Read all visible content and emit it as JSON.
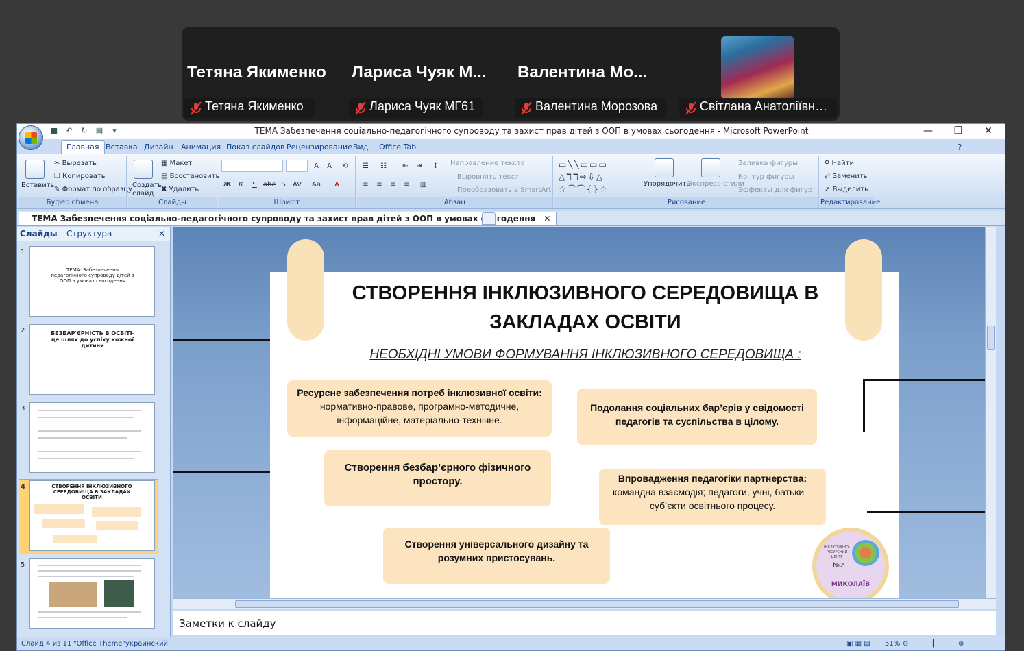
{
  "meeting_strip": {
    "participants": [
      {
        "display_name": "Тетяна Якименко",
        "tag_name": "Тетяна Якименко"
      },
      {
        "display_name": "Лариса Чуяк М...",
        "tag_name": "Лариса Чуяк МГ61"
      },
      {
        "display_name": "Валентина Мо...",
        "tag_name": "Валентина Морозова"
      },
      {
        "display_name": "",
        "tag_name": "Світлана Анатоліївна ..."
      }
    ]
  },
  "window": {
    "title": "ТЕМА Забезпечення соціально-педагогічного супроводу та захист прав дітей з ООП в умовах сьогодення  - Microsoft PowerPoint",
    "minimize": "—",
    "maximize": "❐",
    "close": "✕"
  },
  "ribbon_tabs": [
    "Главная",
    "Вставка",
    "Дизайн",
    "Анимация",
    "Показ слайдов",
    "Рецензирование",
    "Вид",
    "Office Tab"
  ],
  "ribbon": {
    "clipboard": {
      "paste": "Вставить",
      "cut": "Вырезать",
      "copy": "Копировать",
      "format_painter": "Формат по образцу",
      "label": "Буфер обмена"
    },
    "slides": {
      "new_slide": "Создать слайд",
      "layout": "Макет",
      "reset": "Восстановить",
      "delete": "Удалить",
      "label": "Слайды"
    },
    "font": {
      "label": "Шрифт"
    },
    "paragraph": {
      "text_direction": "Направление текста",
      "align_text": "Выровнять текст",
      "smartart": "Преобразовать в SmartArt",
      "label": "Абзац"
    },
    "drawing": {
      "arrange": "Упорядочить",
      "quick_styles": "Экспресс-стили",
      "fill": "Заливка фигуры",
      "outline": "Контур фигуры",
      "effects": "Эффекты для фигур",
      "label": "Рисование"
    },
    "editing": {
      "find": "Найти",
      "replace": "Заменить",
      "select": "Выделить",
      "label": "Редактирование"
    }
  },
  "document_tab": "ТЕМА Забезпечення соціально-педагогічного супроводу та захист прав дітей з ООП в умовах сьогодення",
  "pane": {
    "tab_slides": "Слайды",
    "tab_outline": "Структура",
    "thumbnails": [
      {
        "number": "1",
        "text": "ТЕМА: Забезпечення педагогічного супроводу дітей з ООП в умовах сьогодення"
      },
      {
        "number": "2",
        "text": "БЕЗБАР'ЄРНІСТЬ В ОСВІТІ- це шлях до успіху кожної дитини"
      },
      {
        "number": "3",
        "text": ""
      },
      {
        "number": "4",
        "text": "СТВОРЕННЯ ІНКЛЮЗИВНОГО СЕРЕДОВИЩА В ЗАКЛАДАХ ОСВІТИ"
      },
      {
        "number": "5",
        "text": ""
      }
    ]
  },
  "slide": {
    "title": "СТВОРЕННЯ ІНКЛЮЗИВНОГО СЕРЕДОВИЩА В ЗАКЛАДАХ ОСВІТИ",
    "subtitle": "НЕОБХІДНІ УМОВИ ФОРМУВАННЯ ІНКЛЮЗИВНОГО СЕРЕДОВИЩА :",
    "box1_bold": "Ресурсне забезпечення потреб інклюзивної освіти:",
    "box1_text": "нормативно-правове, програмно-методичне, інформаційне, матеріально-технічне.",
    "box2": "Подолання соціальних бар’єрів у свідомості педагогів та суспільства в цілому.",
    "box3": "Створення безбар’єрного фізичного простору.",
    "box4_bold": "Впровадження педагогіки партнерства:",
    "box4_text": "командна взаємодія; педагоги, учні, батьки – суб’єкти освітнього процесу.",
    "box5": "Створення універсального дизайну та розумних пристосувань.",
    "logo_top": "ІНКЛЮЗИВНО- РЕСУРСНИЙ ЦЕНТР",
    "logo_num": "№2",
    "logo_city": "МИКОЛАЇВ"
  },
  "notes_placeholder": "Заметки к слайду",
  "status": {
    "slide": "Слайд 4 из 11",
    "theme": "\"Office Theme\"",
    "lang": "украинский",
    "zoom": "51%"
  }
}
